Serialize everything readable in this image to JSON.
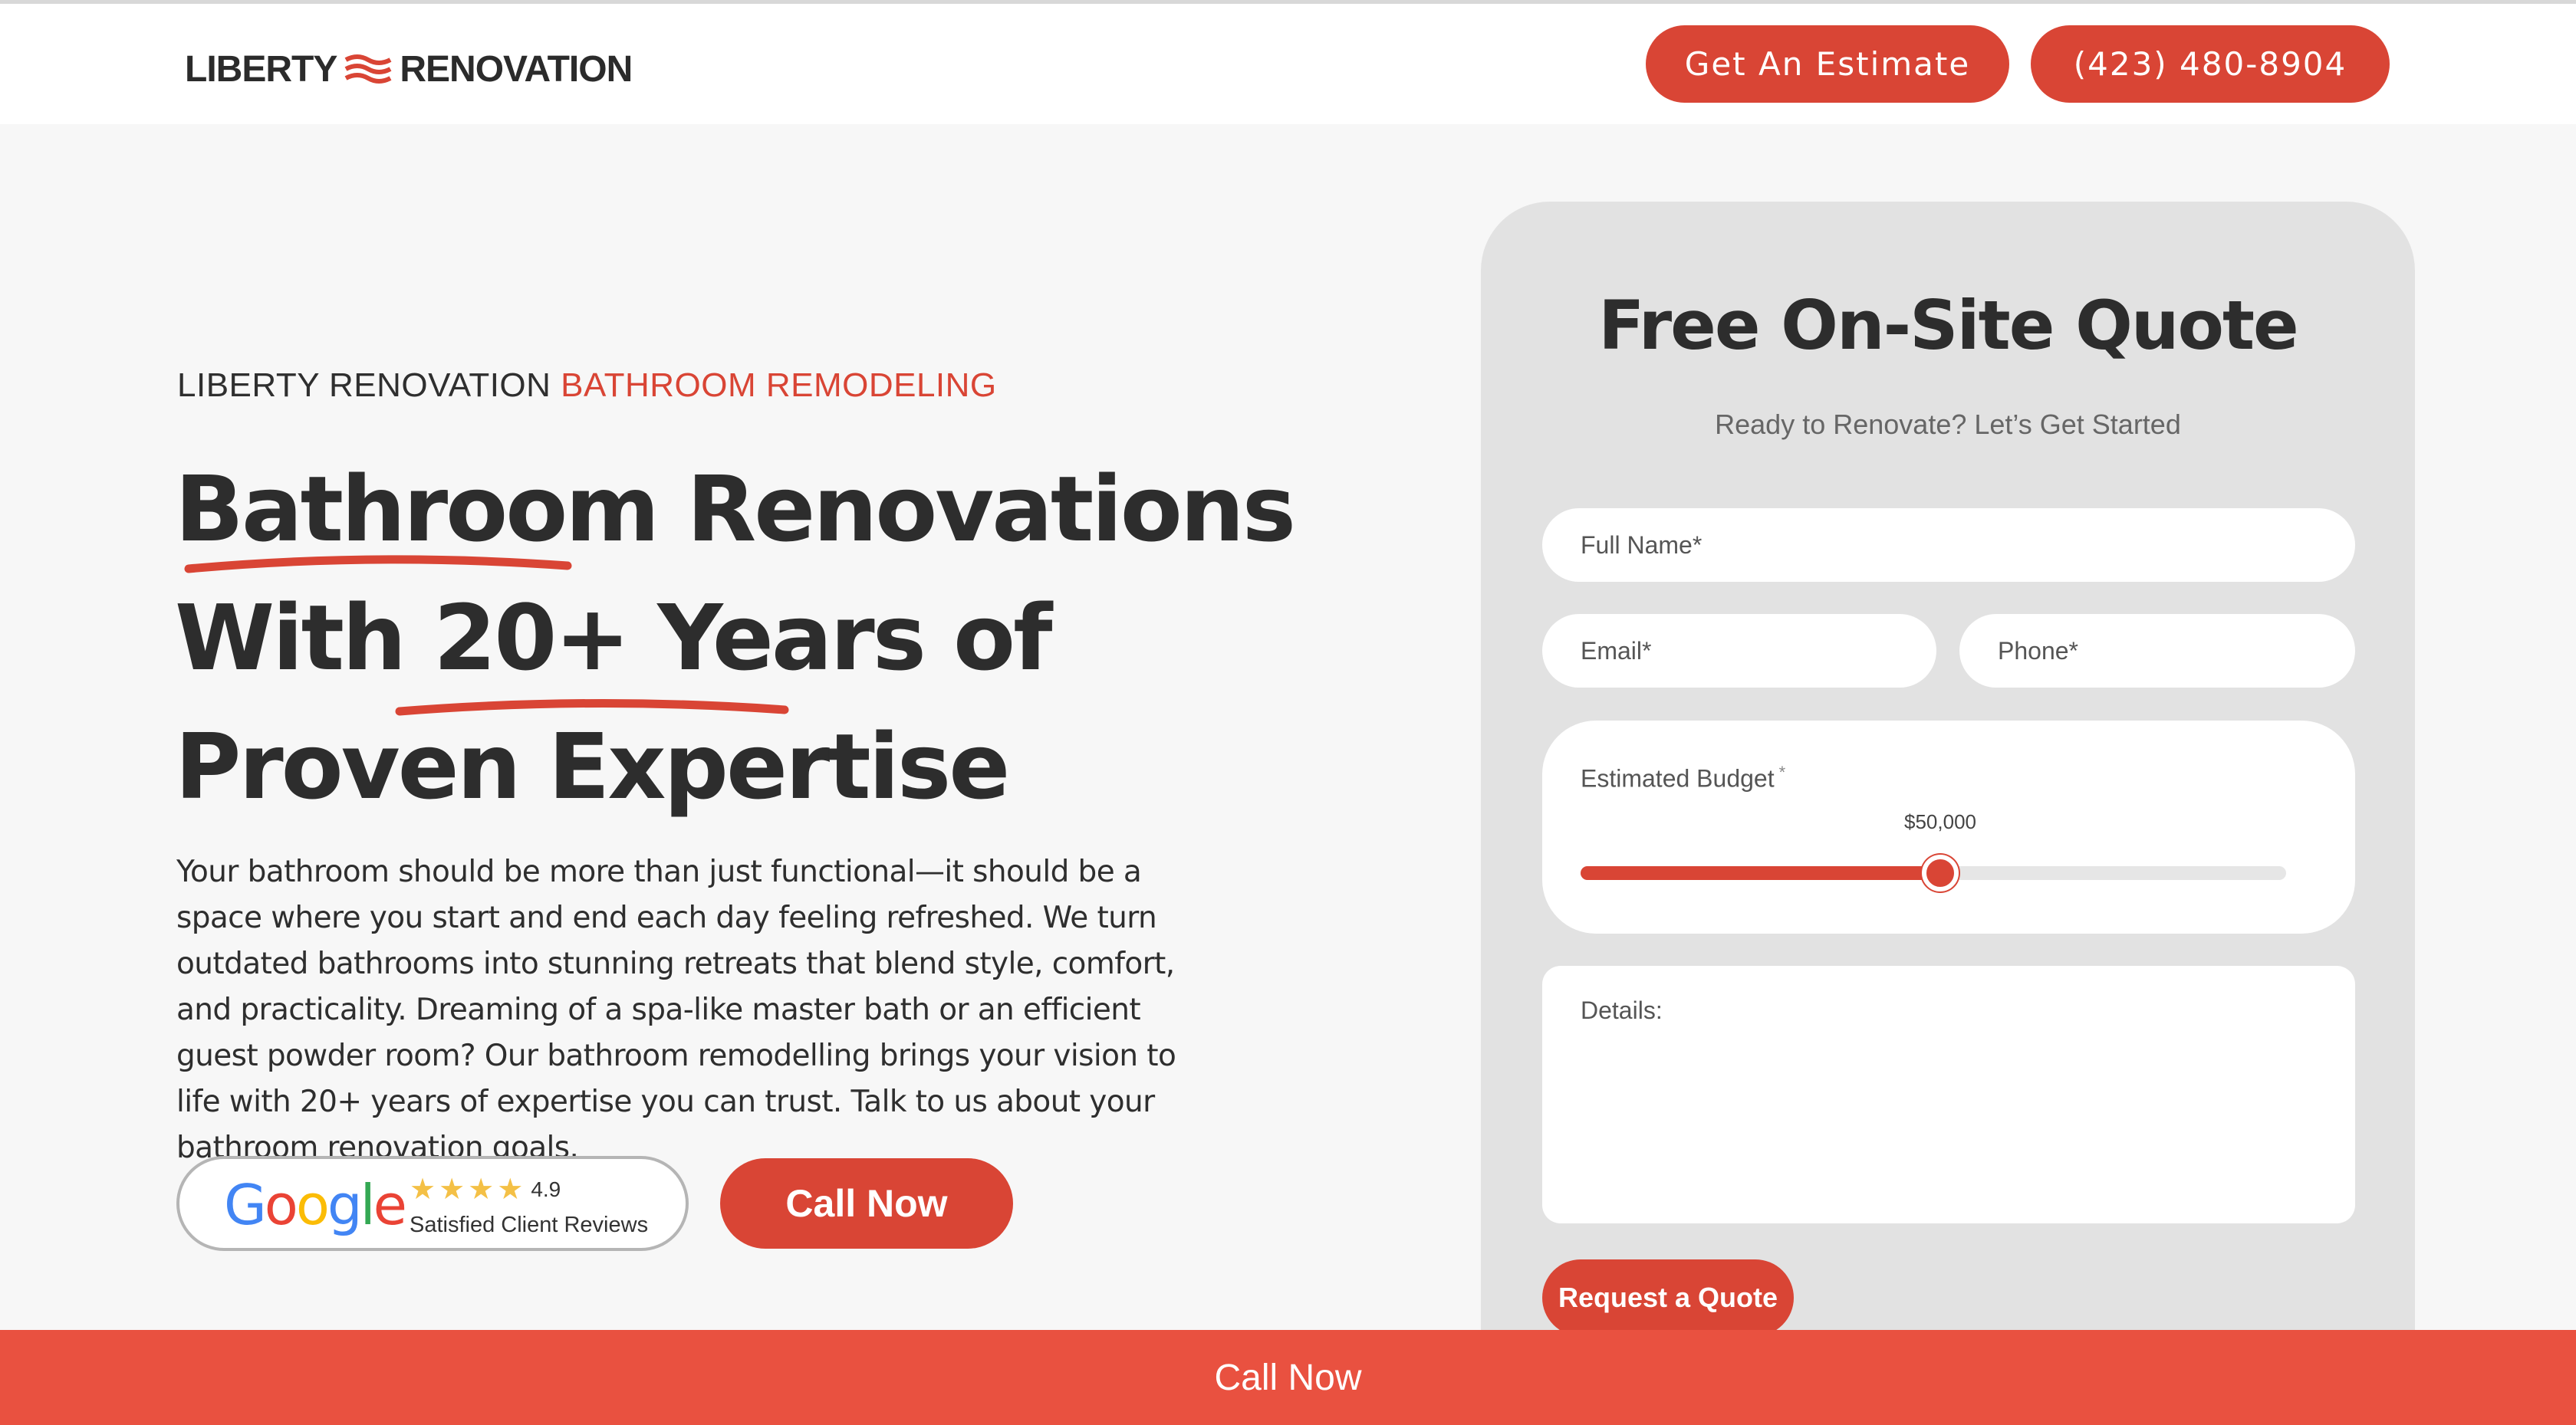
{
  "brand": {
    "name_left": "LIBERTY",
    "name_right": "RENOVATION",
    "accent_color": "#d94535",
    "bar_color": "#e95140"
  },
  "header": {
    "estimate_label": "Get An Estimate",
    "phone_label": "(423) 480-8904"
  },
  "hero": {
    "eyebrow_main": "LIBERTY RENOVATION ",
    "eyebrow_accent": "BATHROOM REMODELING",
    "headline": [
      "Bathroom Renovations",
      "With 20+ Years of",
      "Proven Expertise"
    ],
    "body": "Your bathroom should be more than just functional—it should be a space where you start and end each day feeling refreshed. We turn outdated bathrooms into stunning retreats that blend style, comfort, and practicality. Dreaming of a spa-like master bath or an efficient guest powder room? Our bathroom remodelling brings your vision to life with 20+ years of expertise you can trust. Talk to us about your bathroom renovation goals.",
    "reviews": {
      "rating": "4.9",
      "stars": 4,
      "label": "Satisfied Client Reviews"
    },
    "call_label": "Call Now"
  },
  "form": {
    "title": "Free On-Site Quote",
    "subtitle": "Ready to Renovate? Let’s Get Started",
    "full_name_placeholder": "Full Name*",
    "email_placeholder": "Email*",
    "phone_placeholder": "Phone*",
    "budget_label": "Estimated Budget",
    "budget_required": "*",
    "budget_value": "$50,000",
    "budget_fraction": 0.51,
    "details_placeholder": "Details:",
    "submit_label": "Request a Quote"
  },
  "bottom_bar": {
    "label": "Call Now"
  },
  "icons": {
    "logo_mark": "wave-flag-icon",
    "review_logo": "google-logo",
    "star": "star-icon"
  }
}
